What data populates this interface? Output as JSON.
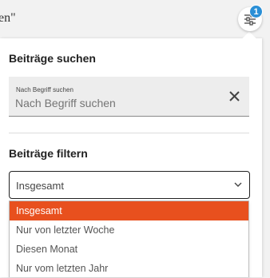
{
  "header": {
    "title": "en\""
  },
  "filter_button": {
    "badge_count": "1",
    "icon": "sliders-icon"
  },
  "search_section": {
    "title": "Beiträge suchen",
    "field_label": "Nach Begriff suchen",
    "placeholder": "Nach Begriff suchen",
    "clear_icon": "close-icon"
  },
  "filter_section": {
    "title": "Beiträge filtern",
    "selected_value": "Insgesamt",
    "options": [
      "Insgesamt",
      "Nur von letzter Woche",
      "Diesen Monat",
      "Nur vom letzten Jahr"
    ]
  },
  "colors": {
    "accent": "#e8501e",
    "badge": "#2a8fd6"
  }
}
